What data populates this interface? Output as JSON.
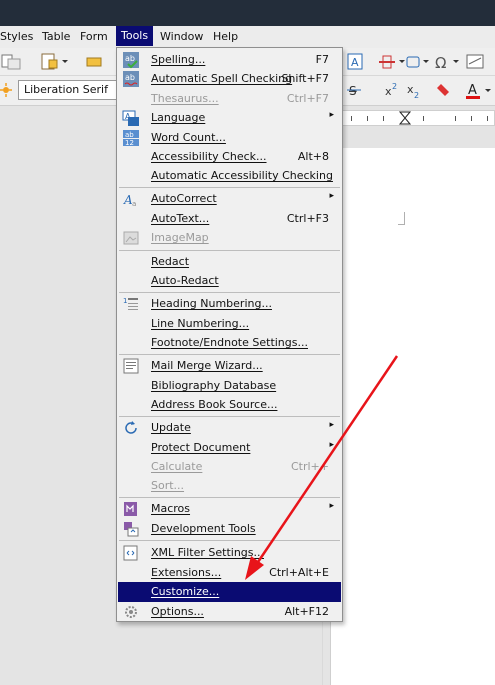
{
  "menubar": {
    "items": [
      {
        "label": "Styles"
      },
      {
        "label": "Table"
      },
      {
        "label": "Form"
      },
      {
        "label": "Tools",
        "active": true
      },
      {
        "label": "Window"
      },
      {
        "label": "Help"
      }
    ]
  },
  "toolbar": {
    "font_name": "Liberation Serif"
  },
  "colors": {
    "highlight": "#0a0b72",
    "annotation_arrow": "#e8141a"
  },
  "tools_menu": {
    "items": [
      {
        "label": "Spelling...",
        "shortcut": "F7",
        "icon": "spelling-icon"
      },
      {
        "label": "Automatic Spell Checking",
        "shortcut": "Shift+F7",
        "icon": "auto-spell-icon"
      },
      {
        "label": "Thesaurus...",
        "shortcut": "Ctrl+F7",
        "disabled": true
      },
      {
        "label": "Language",
        "submenu": true,
        "icon": "language-icon"
      },
      {
        "label": "Word Count...",
        "icon": "word-count-icon"
      },
      {
        "label": "Accessibility Check...",
        "shortcut": "Alt+8"
      },
      {
        "label": "Automatic Accessibility Checking"
      },
      {
        "label": "AutoCorrect",
        "submenu": true,
        "icon": "autocorrect-icon"
      },
      {
        "label": "AutoText...",
        "shortcut": "Ctrl+F3"
      },
      {
        "label": "ImageMap",
        "disabled": true,
        "icon": "imagemap-icon"
      },
      {
        "label": "Redact"
      },
      {
        "label": "Auto-Redact"
      },
      {
        "label": "Heading Numbering...",
        "icon": "heading-numbering-icon"
      },
      {
        "label": "Line Numbering..."
      },
      {
        "label": "Footnote/Endnote Settings..."
      },
      {
        "label": "Mail Merge Wizard...",
        "icon": "mail-merge-icon"
      },
      {
        "label": "Bibliography Database"
      },
      {
        "label": "Address Book Source..."
      },
      {
        "label": "Update",
        "submenu": true,
        "icon": "update-icon"
      },
      {
        "label": "Protect Document",
        "submenu": true
      },
      {
        "label": "Calculate",
        "shortcut": "Ctrl++",
        "disabled": true
      },
      {
        "label": "Sort...",
        "disabled": true
      },
      {
        "label": "Macros",
        "submenu": true,
        "icon": "macros-icon"
      },
      {
        "label": "Development Tools",
        "icon": "dev-tools-icon"
      },
      {
        "label": "XML Filter Settings...",
        "icon": "xml-filter-icon"
      },
      {
        "label": "Extensions...",
        "shortcut": "Ctrl+Alt+E"
      },
      {
        "label": "Customize...",
        "highlighted": true
      },
      {
        "label": "Options...",
        "shortcut": "Alt+F12",
        "icon": "options-gear-icon"
      }
    ]
  }
}
